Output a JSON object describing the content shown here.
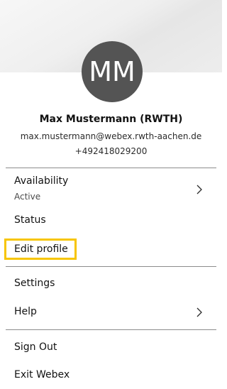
{
  "profile": {
    "initials": "MM",
    "name": "Max Mustermann (RWTH)",
    "email": "max.mustermann@webex.rwth-aachen.de",
    "phone": "+492418029200"
  },
  "menu": {
    "availability": {
      "label": "Availability",
      "sub": "Active"
    },
    "status": {
      "label": "Status"
    },
    "edit_profile": {
      "label": "Edit profile"
    },
    "settings": {
      "label": "Settings"
    },
    "help": {
      "label": "Help"
    },
    "sign_out": {
      "label": "Sign Out"
    },
    "exit": {
      "label": "Exit Webex"
    }
  },
  "colors": {
    "avatar_bg": "#545454",
    "focus_ring": "#f7c500",
    "divider": "#8c8c8c"
  }
}
